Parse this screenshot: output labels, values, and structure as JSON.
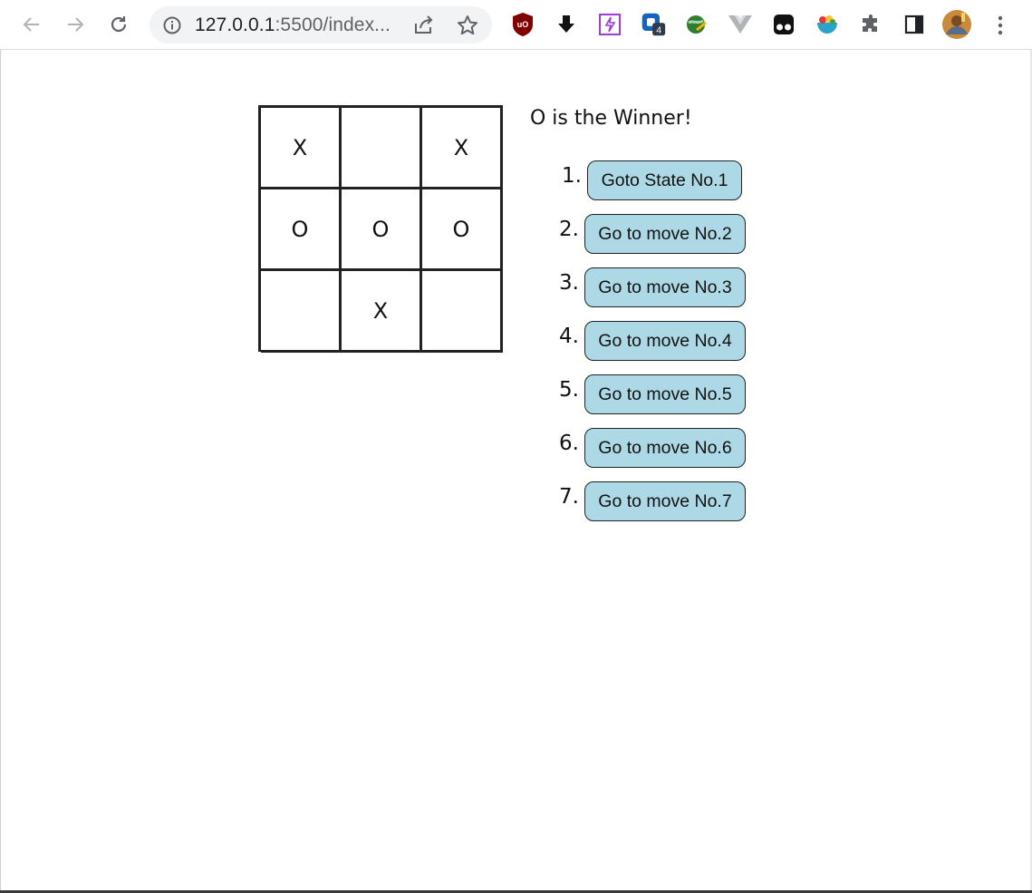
{
  "browser": {
    "url_host": "127.0.0.1",
    "url_rest": ":5500/index...",
    "extension_badge": "4"
  },
  "game": {
    "board": [
      "X",
      "",
      "X",
      "O",
      "O",
      "O",
      "",
      "X",
      ""
    ],
    "status": "O is the Winner!",
    "moves": [
      {
        "num": "1.",
        "label": "Goto State No.1"
      },
      {
        "num": "2.",
        "label": "Go to move No.2"
      },
      {
        "num": "3.",
        "label": "Go to move No.3"
      },
      {
        "num": "4.",
        "label": "Go to move No.4"
      },
      {
        "num": "5.",
        "label": "Go to move No.5"
      },
      {
        "num": "6.",
        "label": "Go to move No.6"
      },
      {
        "num": "7.",
        "label": "Go to move No.7"
      }
    ]
  },
  "colors": {
    "move_button_bg": "#add8e6",
    "board_line": "#222222"
  }
}
